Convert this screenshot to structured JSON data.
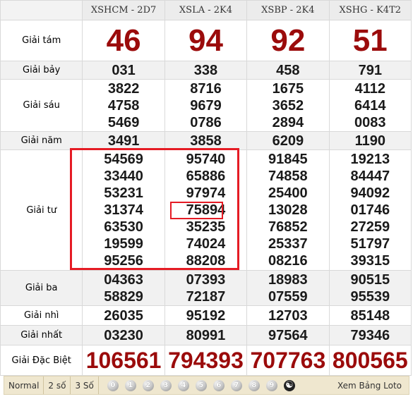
{
  "headers": [
    "XSHCM - 2D7",
    "XSLA - 2K4",
    "XSBP - 2K4",
    "XSHG - K4T2"
  ],
  "rows": [
    {
      "label": "Giải tám",
      "values": [
        [
          "46"
        ],
        [
          "94"
        ],
        [
          "92"
        ],
        [
          "51"
        ]
      ]
    },
    {
      "label": "Giải bảy",
      "values": [
        [
          "031"
        ],
        [
          "338"
        ],
        [
          "458"
        ],
        [
          "791"
        ]
      ]
    },
    {
      "label": "Giải sáu",
      "values": [
        [
          "3822",
          "4758",
          "5469"
        ],
        [
          "8716",
          "9679",
          "0786"
        ],
        [
          "1675",
          "3652",
          "2894"
        ],
        [
          "4112",
          "6414",
          "0083"
        ]
      ]
    },
    {
      "label": "Giải năm",
      "values": [
        [
          "3491"
        ],
        [
          "3858"
        ],
        [
          "6209"
        ],
        [
          "1190"
        ]
      ]
    },
    {
      "label": "Giải tư",
      "values": [
        [
          "54569",
          "33440",
          "53231",
          "31374",
          "63530",
          "19599",
          "95256"
        ],
        [
          "95740",
          "65886",
          "97974",
          "75894",
          "35235",
          "74024",
          "88208"
        ],
        [
          "91845",
          "74858",
          "25400",
          "13028",
          "76852",
          "25337",
          "08216"
        ],
        [
          "19213",
          "84447",
          "94092",
          "01746",
          "27259",
          "51797",
          "39315"
        ]
      ]
    },
    {
      "label": "Giải ba",
      "values": [
        [
          "04363",
          "58829"
        ],
        [
          "07393",
          "72187"
        ],
        [
          "18983",
          "07559"
        ],
        [
          "90515",
          "95539"
        ]
      ]
    },
    {
      "label": "Giải nhì",
      "values": [
        [
          "26035"
        ],
        [
          "95192"
        ],
        [
          "12703"
        ],
        [
          "85148"
        ]
      ]
    },
    {
      "label": "Giải nhất",
      "values": [
        [
          "03230"
        ],
        [
          "80991"
        ],
        [
          "97564"
        ],
        [
          "79346"
        ]
      ]
    },
    {
      "label": "Giải Đặc Biệt",
      "values": [
        [
          "106561"
        ],
        [
          "794393"
        ],
        [
          "707763"
        ],
        [
          "800565"
        ]
      ]
    }
  ],
  "footer": {
    "options": [
      "Normal",
      "2 số",
      "3 Số"
    ],
    "digits": [
      "0",
      "1",
      "2",
      "3",
      "4",
      "5",
      "6",
      "7",
      "8",
      "9"
    ],
    "yinyang": "☯",
    "loto_link": "Xem Bảng Loto"
  },
  "colors": {
    "prize_red": "#9b0b0b",
    "highlight": "#e51b24",
    "footer_bg": "#efe7cf"
  }
}
